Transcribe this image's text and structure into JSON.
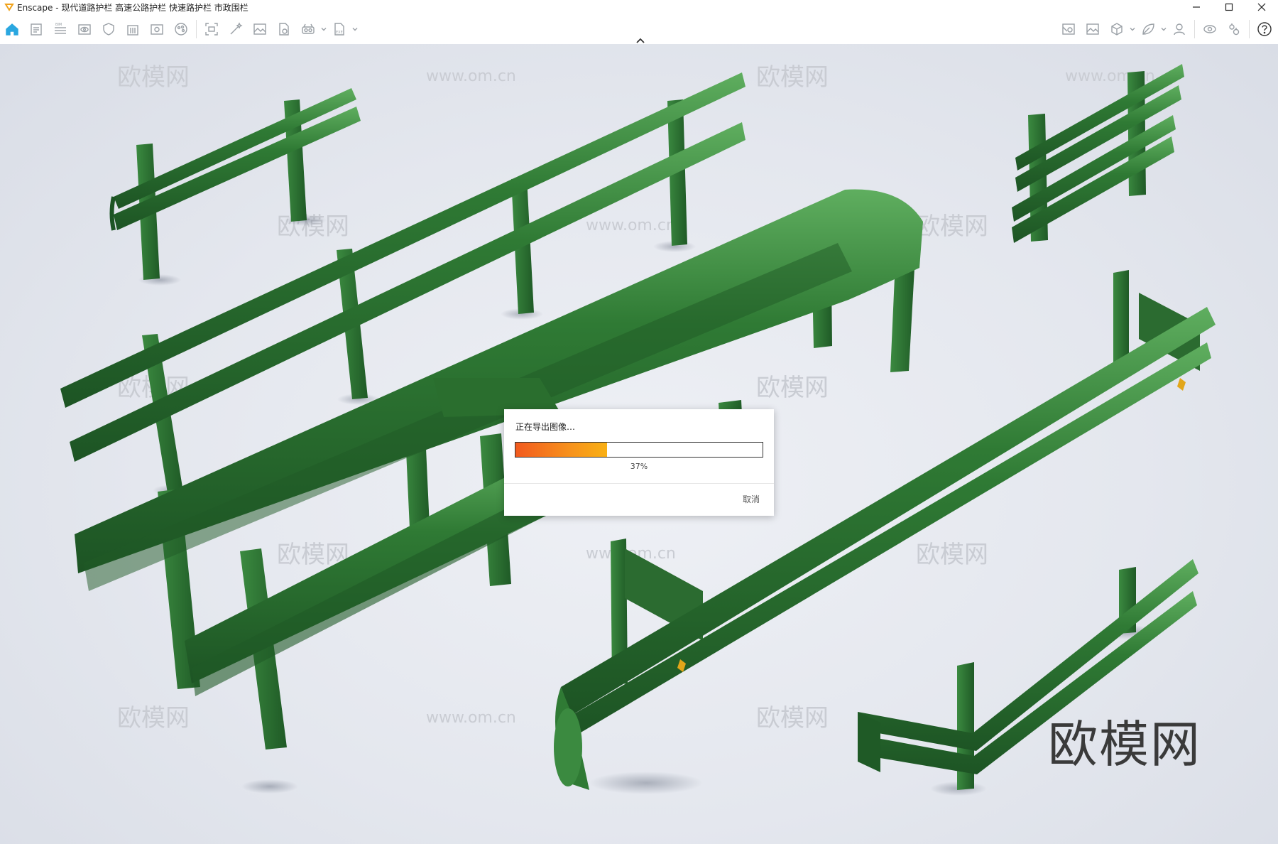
{
  "window": {
    "app_name": "Enscape",
    "title": "Enscape - 现代道路护栏 高速公路护栏 快速路护栏 市政围栏"
  },
  "toolbar": {
    "left_icons": [
      "home-icon",
      "document-icon",
      "bim-list-icon",
      "eye-view-icon",
      "shield-icon",
      "building-icon",
      "image-gear-icon",
      "color-wheel-icon",
      "capture-frame-icon",
      "magic-wand-icon",
      "landscape-image-icon",
      "file-export-icon",
      "vr-headset-icon",
      "export-file-icon"
    ],
    "right_icons": [
      "map-settings-icon",
      "image-preview-icon",
      "cube-icon",
      "asset-leaf-icon",
      "user-settings-icon",
      "visibility-eye-icon",
      "gears-icon",
      "help-icon"
    ]
  },
  "dialog": {
    "title": "正在导出图像…",
    "progress": 37,
    "progress_text": "37%",
    "cancel_label": "取消"
  },
  "viewport": {
    "watermarks": [
      "欧模网",
      "www.om.cn"
    ],
    "logo": "欧模网"
  },
  "colors": {
    "rail_green": "#2f7a34",
    "progress_start": "#f25a1e",
    "progress_end": "#f9b014",
    "home_blue": "#2aa7e0"
  }
}
